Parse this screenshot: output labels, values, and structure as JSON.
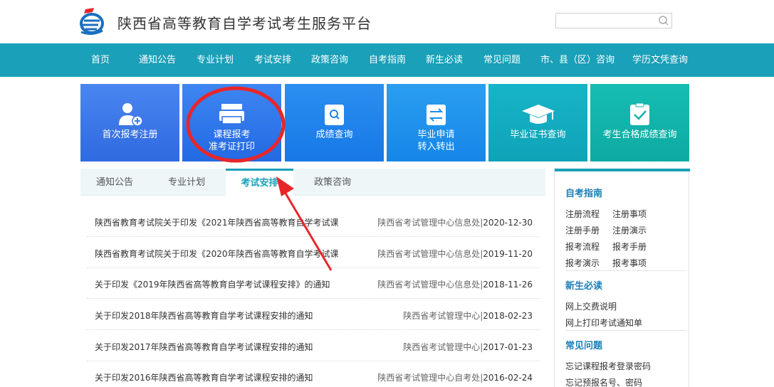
{
  "header": {
    "site_title": "陕西省高等教育自学考试考生服务平台",
    "search_placeholder": ""
  },
  "nav": {
    "items": [
      "首页",
      "通知公告",
      "专业计划",
      "考试安排",
      "政策咨询",
      "自考指南",
      "新生必读",
      "常见问题",
      "市、县（区）咨询",
      "学历文凭查询"
    ]
  },
  "tiles": [
    {
      "line1": "首次报考注册",
      "line2": "",
      "icon": "user-add-icon"
    },
    {
      "line1": "课程报考",
      "line2": "准考证打印",
      "icon": "printer-icon"
    },
    {
      "line1": "成绩查询",
      "line2": "",
      "icon": "search-clipboard-icon"
    },
    {
      "line1": "毕业申请",
      "line2": "转入转出",
      "icon": "transfer-icon"
    },
    {
      "line1": "毕业证书查询",
      "line2": "",
      "icon": "graduation-cap-icon"
    },
    {
      "line1": "考生合格成绩查询",
      "line2": "",
      "icon": "checklist-icon"
    }
  ],
  "tabs": [
    "通知公告",
    "专业计划",
    "考试安排",
    "政策咨询"
  ],
  "active_tab": "考试安排",
  "news": [
    {
      "title": "陕西省教育考试院关于印发《2021年陕西省高等教育自学考试课",
      "source": "陕西省考试管理中心信息处",
      "date": "2020-12-30"
    },
    {
      "title": "陕西省教育考试院关于印发《2020年陕西省高等教育自学考试课",
      "source": "陕西省考试管理中心信息处",
      "date": "2019-11-20"
    },
    {
      "title": "关于印发《2019年陕西省高等教育自学考试课程安排》的通知",
      "source": "陕西省考试管理中心信息处",
      "date": "2018-11-26"
    },
    {
      "title": "关于印发2018年陕西省高等教育自学考试课程安排的通知",
      "source": "陕西省考试管理中心",
      "date": "2018-02-23"
    },
    {
      "title": "关于印发2017年陕西省高等教育自学考试课程安排的通知",
      "source": "陕西省考试管理中心",
      "date": "2017-01-23"
    },
    {
      "title": "关于印发2016年陕西省高等教育自学考试课程安排的通知",
      "source": "陕西省考试管理中心自考处",
      "date": "2016-02-24"
    }
  ],
  "sidebar": {
    "guide_title": "自考指南",
    "guide_links": [
      "注册流程",
      "注册事项",
      "注册手册",
      "注册演示",
      "报考流程",
      "报考手册",
      "报考演示",
      "报考事项"
    ],
    "freshman_title": "新生必读",
    "freshman_links": [
      "网上交费说明",
      "网上打印考试通知单"
    ],
    "faq_title": "常见问题",
    "faq_links": [
      "忘记课程报考登录密码",
      "忘记预报名号、密码"
    ]
  },
  "colors": {
    "nav_bg": "#1aa0b8",
    "accent": "#1aa0b8",
    "annotation": "#e8262a"
  }
}
